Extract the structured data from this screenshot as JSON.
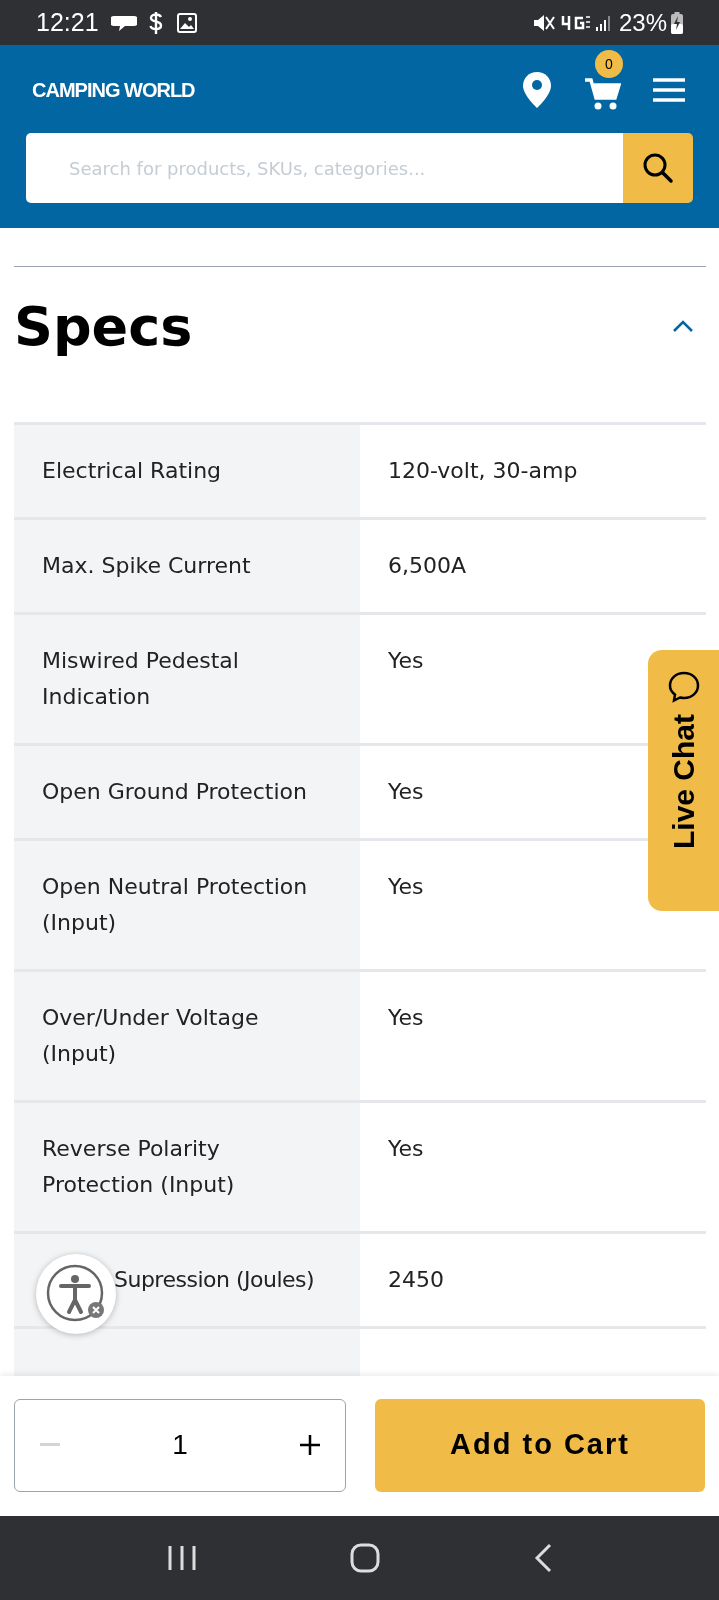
{
  "status_bar": {
    "time": "12:21",
    "battery": "23%"
  },
  "header": {
    "logo": "CAMPING WORLD",
    "cart_count": "0",
    "search": {
      "placeholder": "Search for products, SKUs, categories..."
    }
  },
  "specs": {
    "title": "Specs",
    "expanded": true,
    "rows": [
      {
        "label": "Electrical Rating",
        "value": "120-volt, 30-amp"
      },
      {
        "label": "Max. Spike Current",
        "value": "6,500A"
      },
      {
        "label": "Miswired Pedestal Indication",
        "value": "Yes"
      },
      {
        "label": "Open Ground Protection",
        "value": "Yes"
      },
      {
        "label": "Open Neutral Protection (Input)",
        "value": "Yes"
      },
      {
        "label": "Over/Under Voltage (Input)",
        "value": "Yes"
      },
      {
        "label": "Reverse Polarity Protection (Input)",
        "value": "Yes"
      },
      {
        "label": "Supression (Joules)",
        "value": "2450",
        "covered": true
      }
    ]
  },
  "live_chat": {
    "label": "Live Chat"
  },
  "purchase": {
    "quantity": "1",
    "decrement_disabled": true,
    "add_to_cart": "Add to Cart"
  }
}
